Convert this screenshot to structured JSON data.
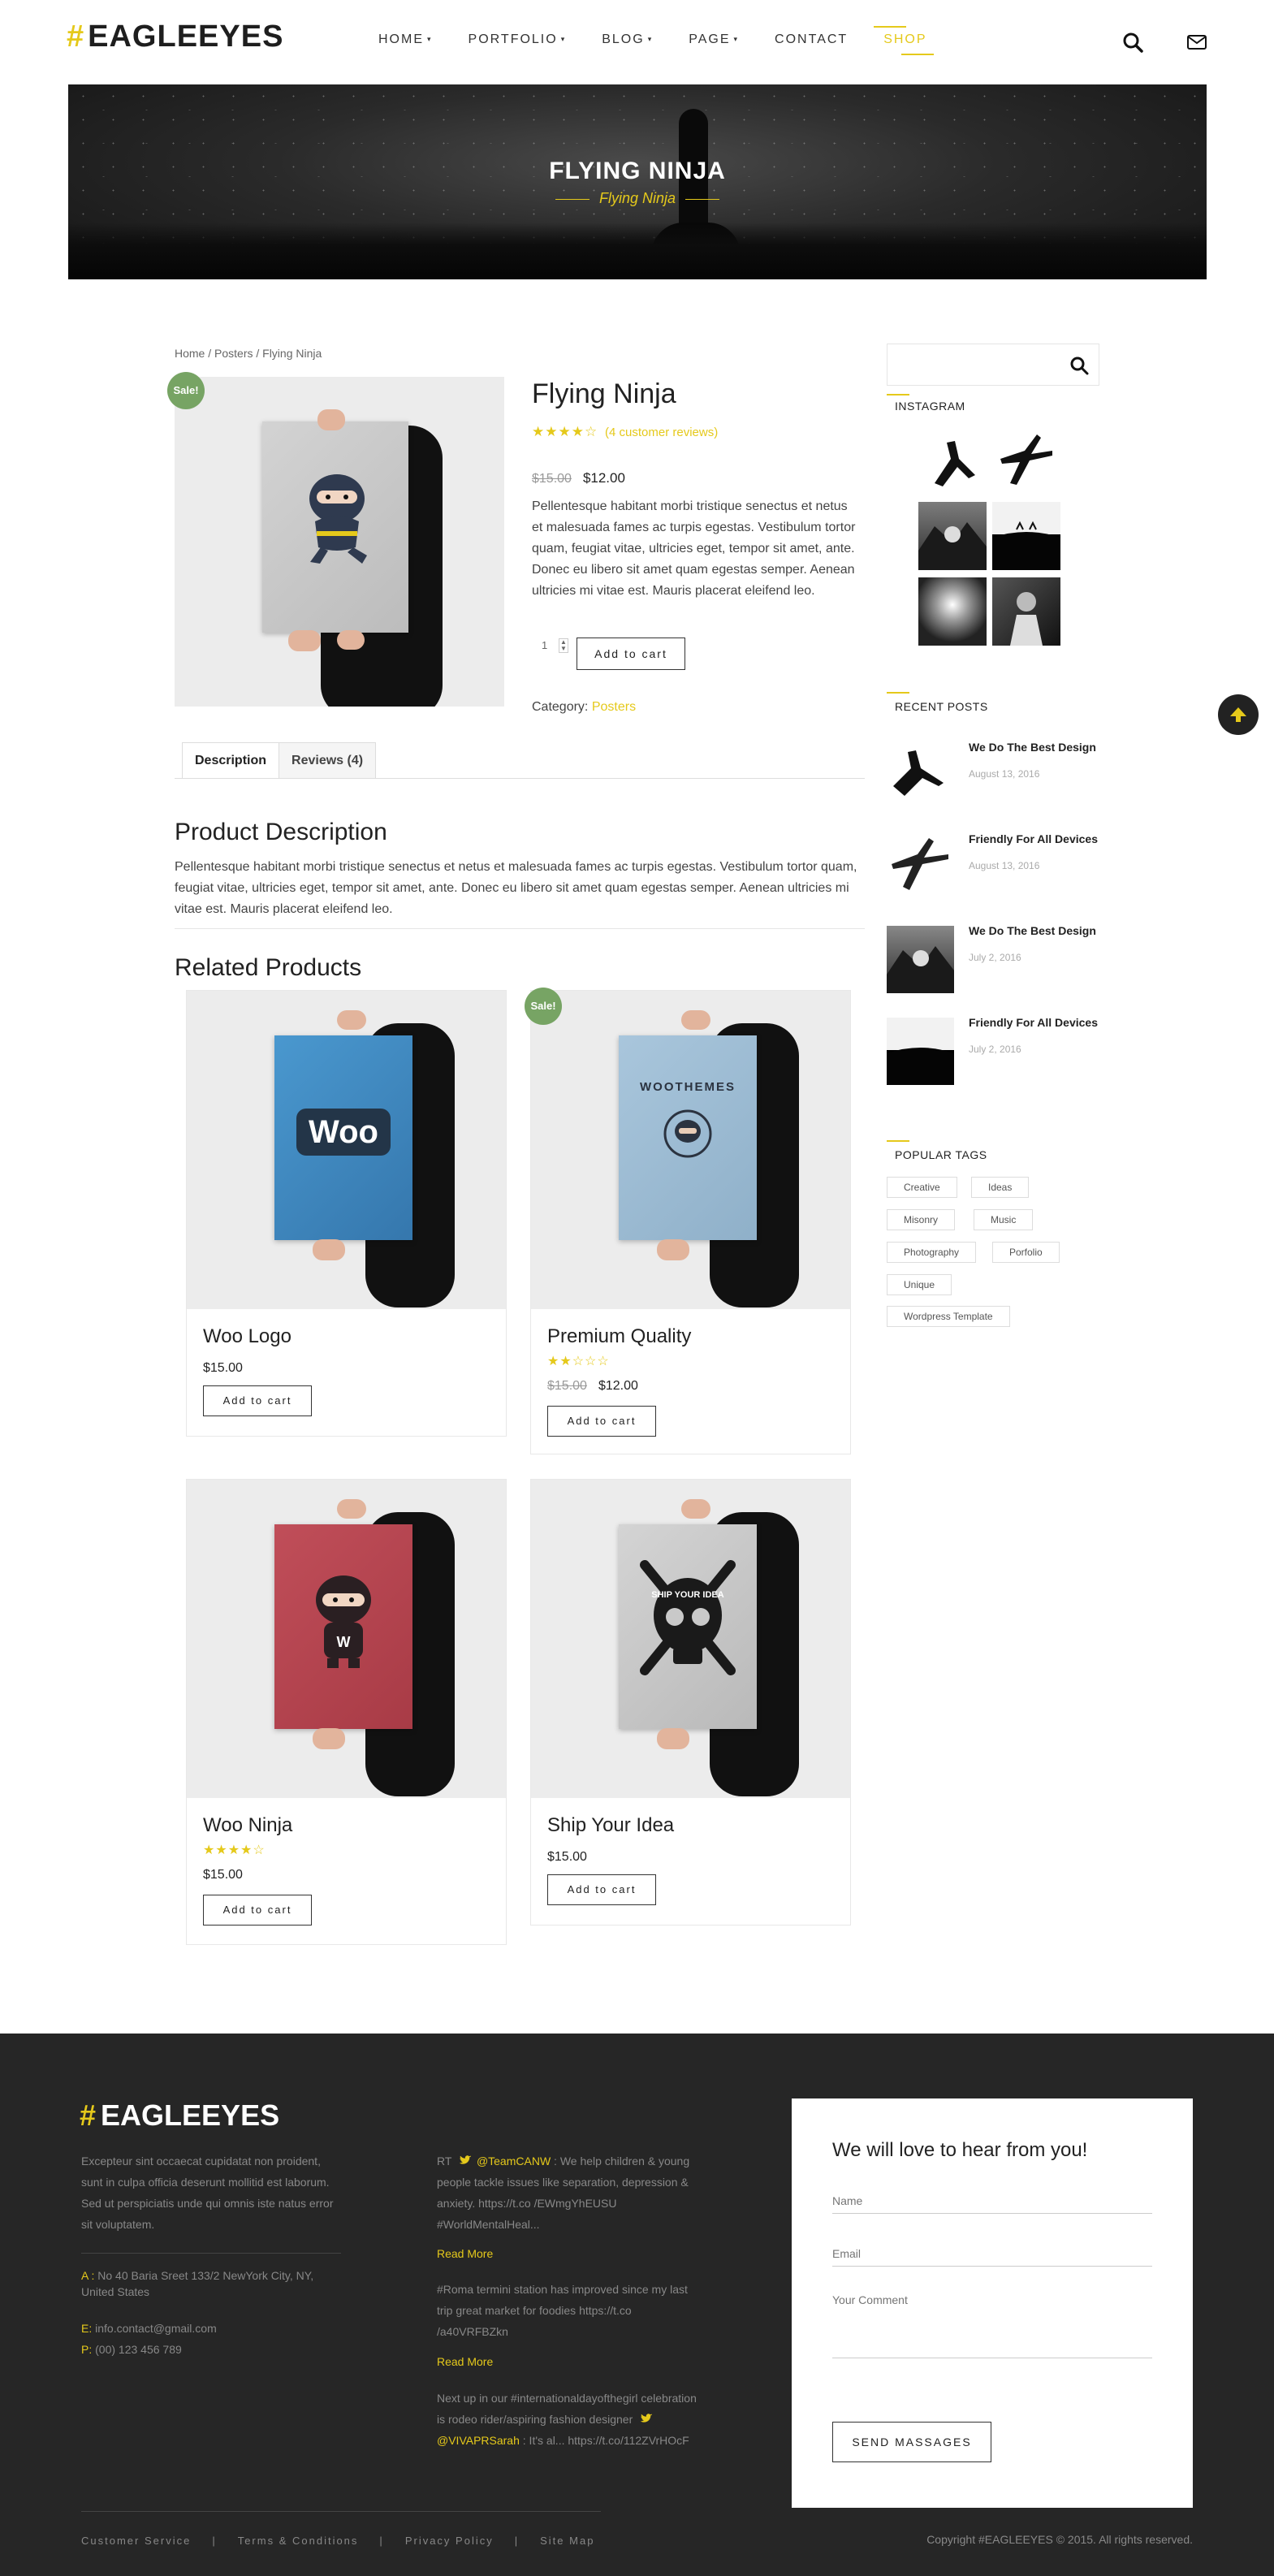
{
  "brand": {
    "hash": "#",
    "name": "EAGLEEYES"
  },
  "nav": {
    "items": [
      {
        "label": "HOME",
        "caret": true
      },
      {
        "label": "PORTFOLIO",
        "caret": true
      },
      {
        "label": "BLOG",
        "caret": true
      },
      {
        "label": "PAGE",
        "caret": true
      },
      {
        "label": "CONTACT",
        "caret": false
      },
      {
        "label": "SHOP",
        "caret": false,
        "active": true
      }
    ],
    "caret_glyph": "▾"
  },
  "banner": {
    "title": "FLYING NINJA",
    "subtitle": "Flying Ninja"
  },
  "breadcrumb": "Home / Posters / Flying Ninja",
  "product": {
    "sale_label": "Sale!",
    "title": "Flying Ninja",
    "rating_stars": "★★★★☆",
    "rating": 4,
    "reviews_link": "(4 customer reviews)",
    "old_price": "$15.00",
    "price": "$12.00",
    "description": "Pellentesque habitant morbi tristique senectus et netus et malesuada fames ac turpis egestas. Vestibulum tortor quam, feugiat vitae, ultricies eget, tempor sit amet, ante. Donec eu libero sit amet quam egestas semper. Aenean ultricies mi vitae est. Mauris placerat eleifend leo.",
    "quantity": "1",
    "add_to_cart": "Add to cart",
    "category_label": "Category:",
    "category_value": "Posters"
  },
  "tabs": [
    {
      "label": "Description",
      "active": true
    },
    {
      "label": "Reviews (4)",
      "active": false
    }
  ],
  "product_description": {
    "heading": "Product Description",
    "text": "Pellentesque habitant morbi tristique senectus et netus et malesuada fames ac turpis egestas. Vestibulum tortor quam, feugiat vitae, ultricies eget, tempor sit amet, ante. Donec eu libero sit amet quam egestas semper. Aenean ultricies mi vitae est. Mauris placerat eleifend leo."
  },
  "related": {
    "heading": "Related Products",
    "items": [
      {
        "name": "Woo Logo",
        "price": "$15.00",
        "old_price": "",
        "stars": "",
        "sale": false,
        "button": "Add to cart",
        "poster_text": "Woo",
        "poster_color": "#3f8cc4"
      },
      {
        "name": "Premium Quality",
        "price": "$12.00",
        "old_price": "$15.00",
        "stars": "★★☆☆☆",
        "sale": true,
        "sale_label": "Sale!",
        "button": "Add to cart",
        "poster_text": "WOOTHEMES",
        "poster_color": "#9fbcd2"
      },
      {
        "name": "Woo Ninja",
        "price": "$15.00",
        "old_price": "",
        "stars": "★★★★☆",
        "sale": false,
        "button": "Add to cart",
        "poster_text": "W",
        "poster_color": "#b9474f"
      },
      {
        "name": "Ship Your Idea",
        "price": "$15.00",
        "old_price": "",
        "stars": "",
        "sale": false,
        "button": "Add to cart",
        "poster_text": "SHIP YOUR IDEA",
        "poster_color": "#c6c6c6"
      }
    ]
  },
  "sidebar": {
    "search_placeholder": "",
    "instagram_title": "INSTAGRAM",
    "recent_title": "RECENT POSTS",
    "recent_posts": [
      {
        "title": "We Do The Best Design",
        "date": "August 13, 2016"
      },
      {
        "title": "Friendly For All Devices",
        "date": "August 13, 2016"
      },
      {
        "title": "We Do The Best Design",
        "date": "July 2, 2016"
      },
      {
        "title": "Friendly For All Devices",
        "date": "July 2, 2016"
      }
    ],
    "tags_title": "POPULAR TAGS",
    "tags": [
      "Creative",
      "Ideas",
      "Misonry",
      "Music",
      "Photography",
      "Porfolio",
      "Unique",
      "Wordpress Template"
    ]
  },
  "footer": {
    "about": "Excepteur sint occaecat cupidatat non proident, sunt in culpa officia deserunt mollitid est laborum. Sed ut perspiciatis unde qui omnis iste natus error sit voluptatem.",
    "address_label": "A :",
    "address": "No 40 Baria Sreet 133/2 NewYork City, NY, United States",
    "email_label": "E:",
    "email": "info.contact@gmail.com",
    "phone_label": "P:",
    "phone": "(00) 123 456 789",
    "tweets": [
      {
        "prefix": "RT",
        "handle": "@TeamCANW",
        "text": ": We help children & young people tackle issues like separation, depression & anxiety. https://t.co /EWmgYhEUSU #WorldMentalHeal...",
        "read_more": "Read More"
      },
      {
        "prefix": "",
        "handle": "",
        "text": "#Roma termini station has improved since my last trip great market for foodies https://t.co /a40VRFBZkn",
        "read_more": "Read More"
      },
      {
        "prefix": "Next up in our #internationaldayofthegirl celebration is rodeo rider/aspiring fashion designer",
        "handle": "@VIVAPRSarah",
        "text": ": It's al... https://t.co/112ZVrHOcF",
        "read_more": ""
      }
    ],
    "form": {
      "title": "We will love to hear from you!",
      "name_placeholder": "Name",
      "email_placeholder": "Email",
      "comment_placeholder": "Your Comment",
      "submit": "SEND MASSAGES"
    },
    "links": [
      "Customer Service",
      "Terms & Conditions",
      "Privacy Policy",
      "Site Map"
    ],
    "link_separator": "|",
    "copyright": "Copyright #EAGLEEYES © 2015. All rights reserved."
  },
  "colors": {
    "accent": "#e5c91b",
    "sale": "#77a464",
    "footer_bg": "#262626",
    "text": "#222222"
  },
  "icons": [
    "search-icon",
    "mail-icon",
    "arrow-up-icon",
    "twitter-icon"
  ]
}
